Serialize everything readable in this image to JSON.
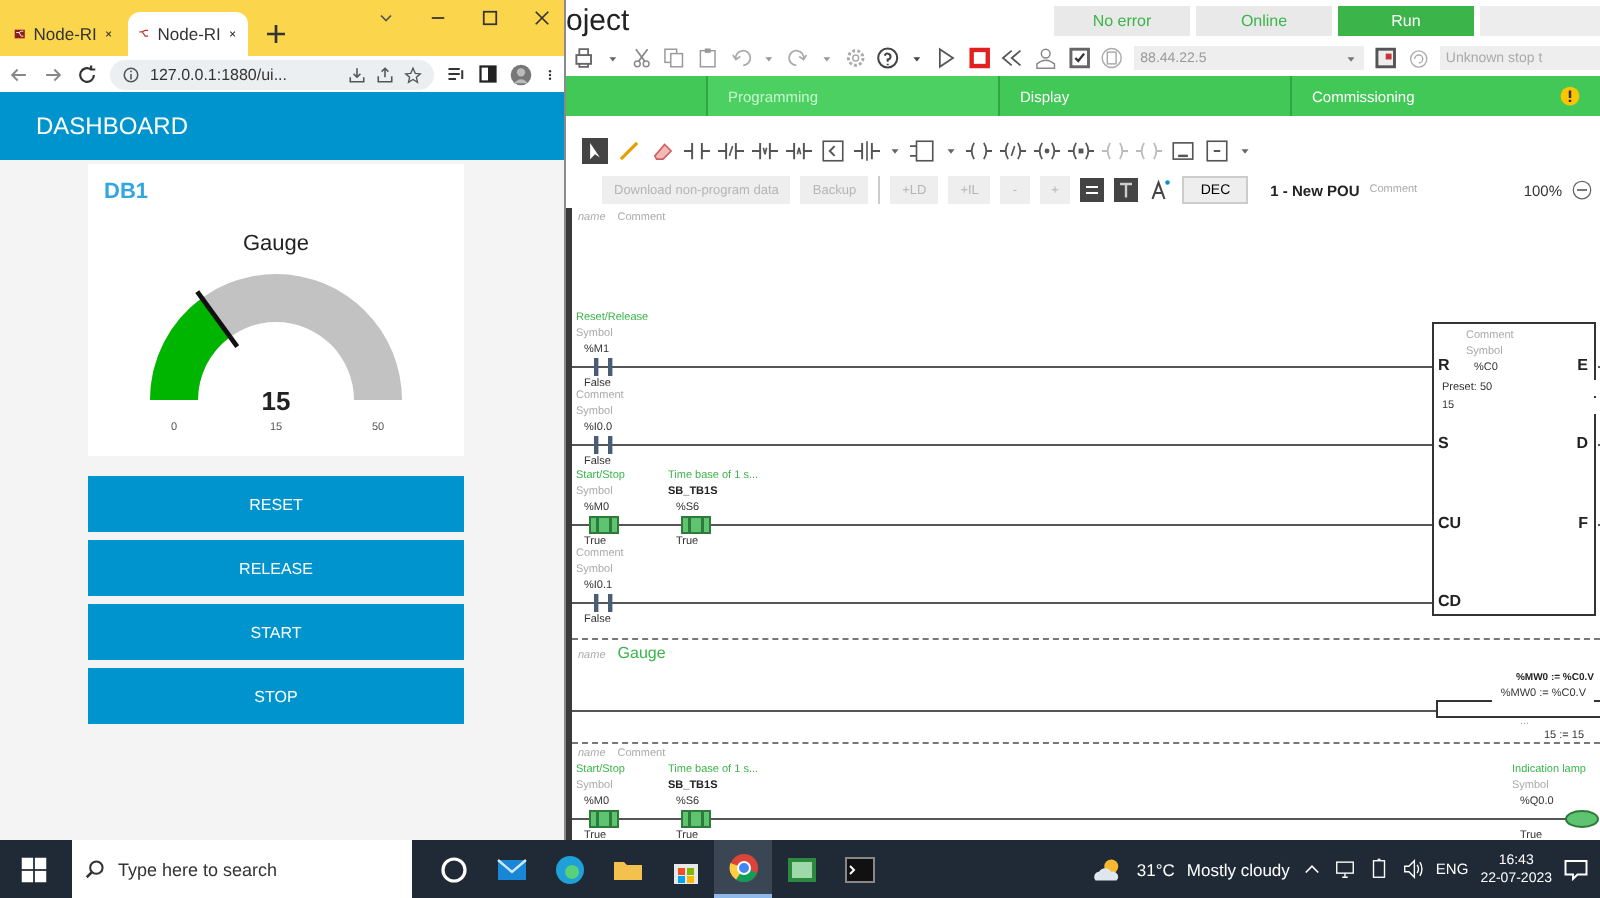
{
  "browser": {
    "tabs": [
      {
        "title": "Node-RI",
        "selected": false
      },
      {
        "title": "Node-RI",
        "selected": true
      }
    ],
    "url": "127.0.0.1:1880/ui...",
    "header": "DASHBOARD",
    "group": {
      "title": "DB1",
      "gauge": {
        "title": "Gauge",
        "value": "15",
        "min": "0",
        "units": "15",
        "max": "50"
      },
      "buttons": [
        "RESET",
        "RELEASE",
        "START",
        "STOP"
      ]
    }
  },
  "app": {
    "title": "oject",
    "status": [
      {
        "label": "No error",
        "on": false
      },
      {
        "label": "Online",
        "on": false
      },
      {
        "label": "Run",
        "on": true
      }
    ],
    "ip": "88.44.22.5",
    "stop_field": "Unknown stop t",
    "tabs": [
      {
        "label": "Programming",
        "selected": true,
        "warning": false
      },
      {
        "label": "Display",
        "selected": false,
        "warning": false
      },
      {
        "label": "Commissioning",
        "selected": false,
        "warning": true
      }
    ],
    "actions": [
      {
        "label": "Download non-program data",
        "disabled": true
      },
      {
        "label": "Backup",
        "disabled": true
      },
      {
        "label": "+LD",
        "disabled": true
      },
      {
        "label": "+IL",
        "disabled": true
      },
      {
        "label": "-",
        "disabled": true
      },
      {
        "label": "+",
        "disabled": true
      }
    ],
    "base": "DEC",
    "pou": "1 - New POU",
    "pou_comment": "Comment",
    "zoom": "100%"
  },
  "rungs": [
    {
      "kind": "ladder",
      "name": "name",
      "comment": "Comment",
      "comment_placeholder": true,
      "lines": [
        {
          "contacts": [
            {
              "comment": "Reset/Release",
              "comment_placeholder": false,
              "symbol": "Symbol",
              "symbol_placeholder": true,
              "address": "%M1",
              "value": "False",
              "on": false
            }
          ]
        },
        {
          "contacts": [
            {
              "comment": "Comment",
              "comment_placeholder": true,
              "symbol": "Symbol",
              "symbol_placeholder": true,
              "address": "%I0.0",
              "value": "False",
              "on": false
            }
          ]
        },
        {
          "contacts": [
            {
              "comment": "Start/Stop",
              "comment_placeholder": false,
              "symbol": "Symbol",
              "symbol_placeholder": true,
              "address": "%M0",
              "value": "True",
              "on": true
            },
            {
              "comment": "Time base of 1 s...",
              "comment_placeholder": false,
              "symbol": "SB_TB1S",
              "symbol_placeholder": false,
              "address": "%S6",
              "value": "True",
              "on": true
            }
          ]
        },
        {
          "contacts": [
            {
              "comment": "Comment",
              "comment_placeholder": true,
              "symbol": "Symbol",
              "symbol_placeholder": true,
              "address": "%I0.1",
              "value": "False",
              "on": false
            }
          ]
        }
      ],
      "block": {
        "comment": "Comment",
        "symbol": "Symbol",
        "address": "%C0",
        "preset": "Preset: 50",
        "value": "15",
        "inputs": [
          "R",
          "S",
          "CU",
          "CD"
        ],
        "outputs": [
          "E",
          "D",
          "F"
        ]
      }
    },
    {
      "kind": "operation",
      "name": "name",
      "comment": "Gauge",
      "comment_placeholder": false,
      "operation": {
        "expr": "%MW0 := %C0.V",
        "expr_address": "%MW0 := %C0.V",
        "ellipsis": "...",
        "result": "15 := 15"
      }
    },
    {
      "kind": "ladder",
      "name": "name",
      "comment": "Comment",
      "comment_placeholder": true,
      "lines": [
        {
          "contacts": [
            {
              "comment": "Start/Stop",
              "comment_placeholder": false,
              "symbol": "Symbol",
              "symbol_placeholder": true,
              "address": "%M0",
              "value": "True",
              "on": true
            },
            {
              "comment": "Time base of 1 s...",
              "comment_placeholder": false,
              "symbol": "SB_TB1S",
              "symbol_placeholder": false,
              "address": "%S6",
              "value": "True",
              "on": true
            }
          ],
          "coil": {
            "comment": "Indication lamp",
            "comment_placeholder": false,
            "symbol": "Symbol",
            "symbol_placeholder": true,
            "address": "%Q0.0",
            "value": "True",
            "on": true
          }
        }
      ]
    }
  ],
  "taskbar": {
    "search_placeholder": "Type here to search",
    "apps": [
      {
        "kind": "taskview",
        "selected": false
      },
      {
        "kind": "mail",
        "selected": false
      },
      {
        "kind": "globe",
        "selected": false
      },
      {
        "kind": "folder",
        "selected": false
      },
      {
        "kind": "store",
        "selected": false
      },
      {
        "kind": "chrome",
        "selected": true
      },
      {
        "kind": "sheet",
        "selected": false
      },
      {
        "kind": "terminal",
        "selected": false
      }
    ],
    "temperature": "31°C",
    "condition": "Mostly cloudy",
    "language": "ENG",
    "time": "16:43",
    "date": "22-07-2023"
  }
}
